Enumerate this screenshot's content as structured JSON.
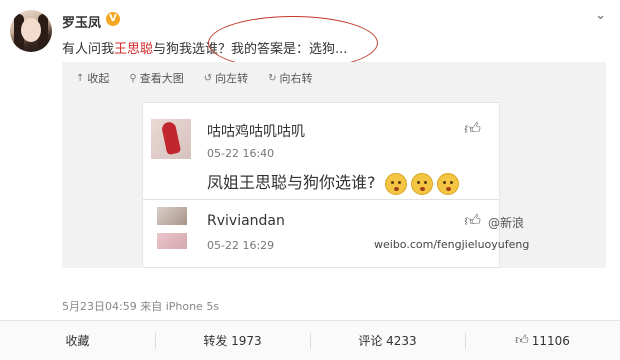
{
  "post": {
    "username": "罗玉凤",
    "vip_badge": "V",
    "text_prefix": "有人问我",
    "mention": "王思聪",
    "text_suffix": "与狗我选谁？我的答案是：选狗...",
    "meta": "5月23日04:59 来自 iPhone 5s"
  },
  "toolbar": {
    "collapse": "收起",
    "view_large": "查看大图",
    "rotate_left": "向左转",
    "rotate_right": "向右转"
  },
  "comments": [
    {
      "name": "咕咕鸡咕叽咕叽",
      "time": "05-22 16:40",
      "text": "凤姐王思聪与狗你选谁?"
    },
    {
      "name": "Rviviandan",
      "time": "05-22 16:29"
    }
  ],
  "watermark": {
    "logo": "@新浪",
    "url": "weibo.com/fengjieluoyufeng"
  },
  "actions": {
    "favorite": "收藏",
    "repost": "转发 1973",
    "comment": "评论 4233",
    "like": "11106"
  },
  "icons": [
    "user-avatar",
    "vip-badge-icon",
    "chevron-down-icon",
    "collapse-icon",
    "zoom-icon",
    "rotate-left-icon",
    "rotate-right-icon",
    "thumbs-up-icon",
    "emoji-icon"
  ],
  "colors": {
    "mention": "#d42b2b",
    "highlight": "#c0392b",
    "badge": "#f5a623"
  }
}
